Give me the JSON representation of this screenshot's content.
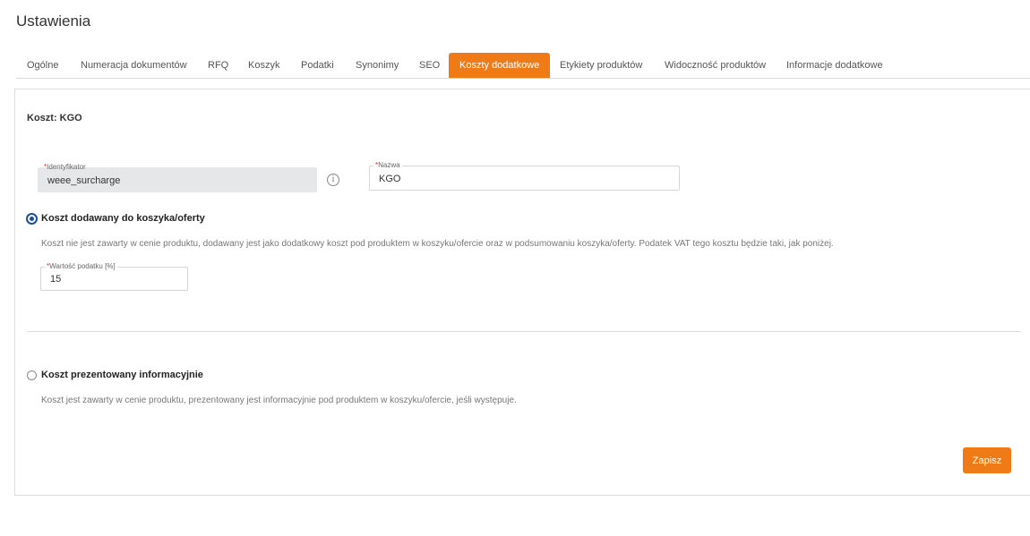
{
  "page": {
    "title": "Ustawienia"
  },
  "tabs": [
    {
      "label": "Ogólne"
    },
    {
      "label": "Numeracja dokumentów"
    },
    {
      "label": "RFQ"
    },
    {
      "label": "Koszyk"
    },
    {
      "label": "Podatki"
    },
    {
      "label": "Synonimy"
    },
    {
      "label": "SEO"
    },
    {
      "label": "Koszty dodatkowe",
      "active": true
    },
    {
      "label": "Etykiety produktów"
    },
    {
      "label": "Widoczność produktów"
    },
    {
      "label": "Informacje dodatkowe"
    }
  ],
  "form": {
    "section_title": "Koszt: KGO",
    "identifier": {
      "label": "Identyfikator",
      "required_mark": "*",
      "value": "weee_surcharge"
    },
    "name": {
      "label": "Nazwa",
      "required_mark": "*",
      "value": "KGO"
    },
    "option_cart": {
      "label": "Koszt dodawany do koszyka/oferty",
      "selected": true,
      "description": "Koszt nie jest zawarty w cenie produktu, dodawany jest jako dodatkowy koszt pod produktem w koszyku/ofercie oraz w podsumowaniu koszyka/oferty. Podatek VAT tego kosztu będzie taki, jak poniżej."
    },
    "tax": {
      "label": "Wartość podatku [%]",
      "required_mark": "*",
      "value": "15"
    },
    "option_info": {
      "label": "Koszt prezentowany informacyjnie",
      "selected": false,
      "description": "Koszt jest zawarty w cenie produktu, prezentowany jest informacyjnie pod produktem w koszyku/ofercie, jeśli występuje."
    },
    "save_label": "Zapisz"
  },
  "colors": {
    "accent": "#ef7b17",
    "radio": "#1c4e9a",
    "required": "#d9342b"
  }
}
